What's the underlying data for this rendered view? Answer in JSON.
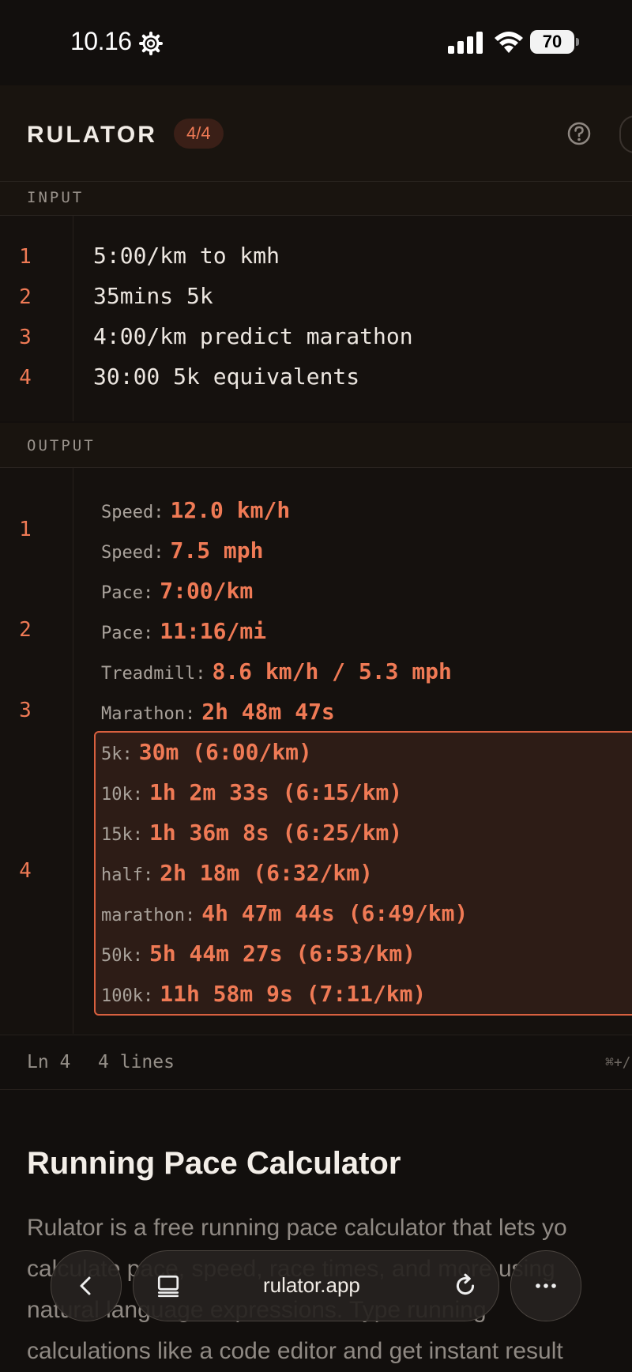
{
  "status_bar": {
    "time": "10.16",
    "battery": "70"
  },
  "app": {
    "title": "RULATOR",
    "badge": "4/4"
  },
  "input": {
    "section_label": "INPUT",
    "lines": [
      {
        "n": "1",
        "text": "5:00/km to kmh"
      },
      {
        "n": "2",
        "text": "35mins 5k"
      },
      {
        "n": "3",
        "text": "4:00/km predict marathon"
      },
      {
        "n": "4",
        "text": "30:00 5k equivalents"
      }
    ]
  },
  "output": {
    "section_label": "OUTPUT",
    "line_numbers": [
      "1",
      "2",
      "3",
      "4"
    ],
    "rows": [
      {
        "label": "Speed:",
        "value": "12.0 km/h"
      },
      {
        "label": "Speed:",
        "value": "7.5 mph"
      },
      {
        "label": "Pace:",
        "value": "7:00/km"
      },
      {
        "label": "Pace:",
        "value": "11:16/mi"
      },
      {
        "label": "Treadmill:",
        "value": "8.6 km/h / 5.3 mph"
      },
      {
        "label": "Marathon:",
        "value": "2h 48m 47s"
      },
      {
        "label": "5k:",
        "value": "30m (6:00/km)"
      },
      {
        "label": "10k:",
        "value": "1h 2m 33s (6:15/km)"
      },
      {
        "label": "15k:",
        "value": "1h 36m 8s (6:25/km)"
      },
      {
        "label": "half:",
        "value": "2h 18m (6:32/km)"
      },
      {
        "label": "marathon:",
        "value": "4h 47m 44s (6:49/km)"
      },
      {
        "label": "50k:",
        "value": "5h 44m 27s (6:53/km)"
      },
      {
        "label": "100k:",
        "value": "11h 58m 9s (7:11/km)"
      }
    ]
  },
  "statusline": {
    "cursor": "Ln 4",
    "lines": "4 lines",
    "shortcut": "⌘+/"
  },
  "article": {
    "heading": "Running Pace Calculator",
    "paragraph_lines": [
      "Rulator is a free running pace calculator that lets yo",
      "calculate pace, speed, race times, and more using",
      "natural language expressions. Type running",
      "calculations like a code editor and get instant result"
    ]
  },
  "browser": {
    "url": "rulator.app"
  },
  "colors": {
    "accent": "#ef7a55",
    "background": "#120f0d"
  }
}
